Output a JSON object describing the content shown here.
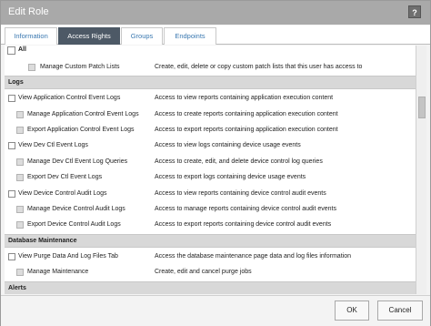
{
  "dialog": {
    "title": "Edit Role",
    "help_label": "?"
  },
  "tabs": [
    {
      "label": "Information"
    },
    {
      "label": "Access Rights"
    },
    {
      "label": "Groups"
    },
    {
      "label": "Endpoints"
    }
  ],
  "all": {
    "label": "All"
  },
  "rows_top": [
    {
      "name": "Manage Custom Patch Lists",
      "desc": "Create, edit, delete or copy custom patch lists that this user has access to"
    }
  ],
  "sections": [
    {
      "title": "Logs"
    },
    {
      "title": "Database Maintenance"
    },
    {
      "title": "Alerts"
    }
  ],
  "logs": [
    {
      "name": "View Application Control Event Logs",
      "desc": "Access to view reports containing application execution content"
    },
    {
      "name": "Manage Application Control Event Logs",
      "desc": "Access to create reports containing application execution content"
    },
    {
      "name": "Export Application Control Event Logs",
      "desc": "Access to export reports containing application execution content"
    },
    {
      "name": "View Dev Ctl Event Logs",
      "desc": "Access to view logs containing device usage events"
    },
    {
      "name": "Manage Dev Ctl Event Log Queries",
      "desc": "Access to create, edit, and delete device control log queries"
    },
    {
      "name": "Export Dev Ctl Event Logs",
      "desc": "Access to export logs containing device usage events"
    },
    {
      "name": "View Device Control Audit Logs",
      "desc": "Access to view reports containing device control audit events"
    },
    {
      "name": "Manage Device Control Audit Logs",
      "desc": "Access to manage reports containing device control audit events"
    },
    {
      "name": "Export Device Control Audit Logs",
      "desc": "Access to export reports containing device control audit events"
    }
  ],
  "db": [
    {
      "name": "View Purge Data And Log Files Tab",
      "desc": "Access the database maintenance page data and log files information"
    },
    {
      "name": "Manage Maintenance",
      "desc": "Create, edit and cancel purge jobs"
    }
  ],
  "footer": {
    "ok_label": "OK",
    "cancel_label": "Cancel"
  }
}
